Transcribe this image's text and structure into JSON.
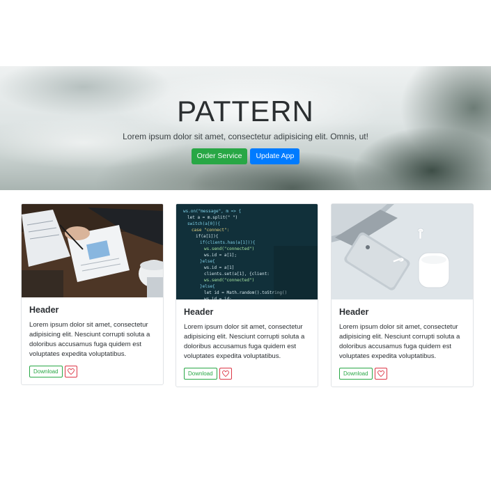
{
  "hero": {
    "title": "PATTERN",
    "lead": "Lorem ipsum dolor sit amet, consectetur adipisicing elit. Omnis, ut!",
    "buttons": [
      {
        "label": "Order Service",
        "color": "#28a745"
      },
      {
        "label": "Update App",
        "color": "#007bff"
      }
    ]
  },
  "cards": [
    {
      "image": "office-desk-photo",
      "title": "Header",
      "text": "Lorem ipsum dolor sit amet, consectetur adipisicing elit. Nesciunt corrupti soluta a doloribus accusamus fuga quidem est voluptates expedita voluptatibus.",
      "download_label": "Download",
      "icon": "heart-icon"
    },
    {
      "image": "code-screen-photo",
      "title": "Header",
      "text": "Lorem ipsum dolor sit amet, consectetur adipisicing elit. Nesciunt corrupti soluta a doloribus accusamus fuga quidem est voluptates expedita voluptatibus.",
      "download_label": "Download",
      "icon": "heart-icon"
    },
    {
      "image": "phone-earbuds-photo",
      "title": "Header",
      "text": "Lorem ipsum dolor sit amet, consectetur adipisicing elit. Nesciunt corrupti soluta a doloribus accusamus fuga quidem est voluptates expedita voluptatibus.",
      "download_label": "Download",
      "icon": "heart-icon"
    }
  ],
  "colors": {
    "success": "#28a745",
    "primary": "#007bff",
    "danger": "#dc3545"
  }
}
